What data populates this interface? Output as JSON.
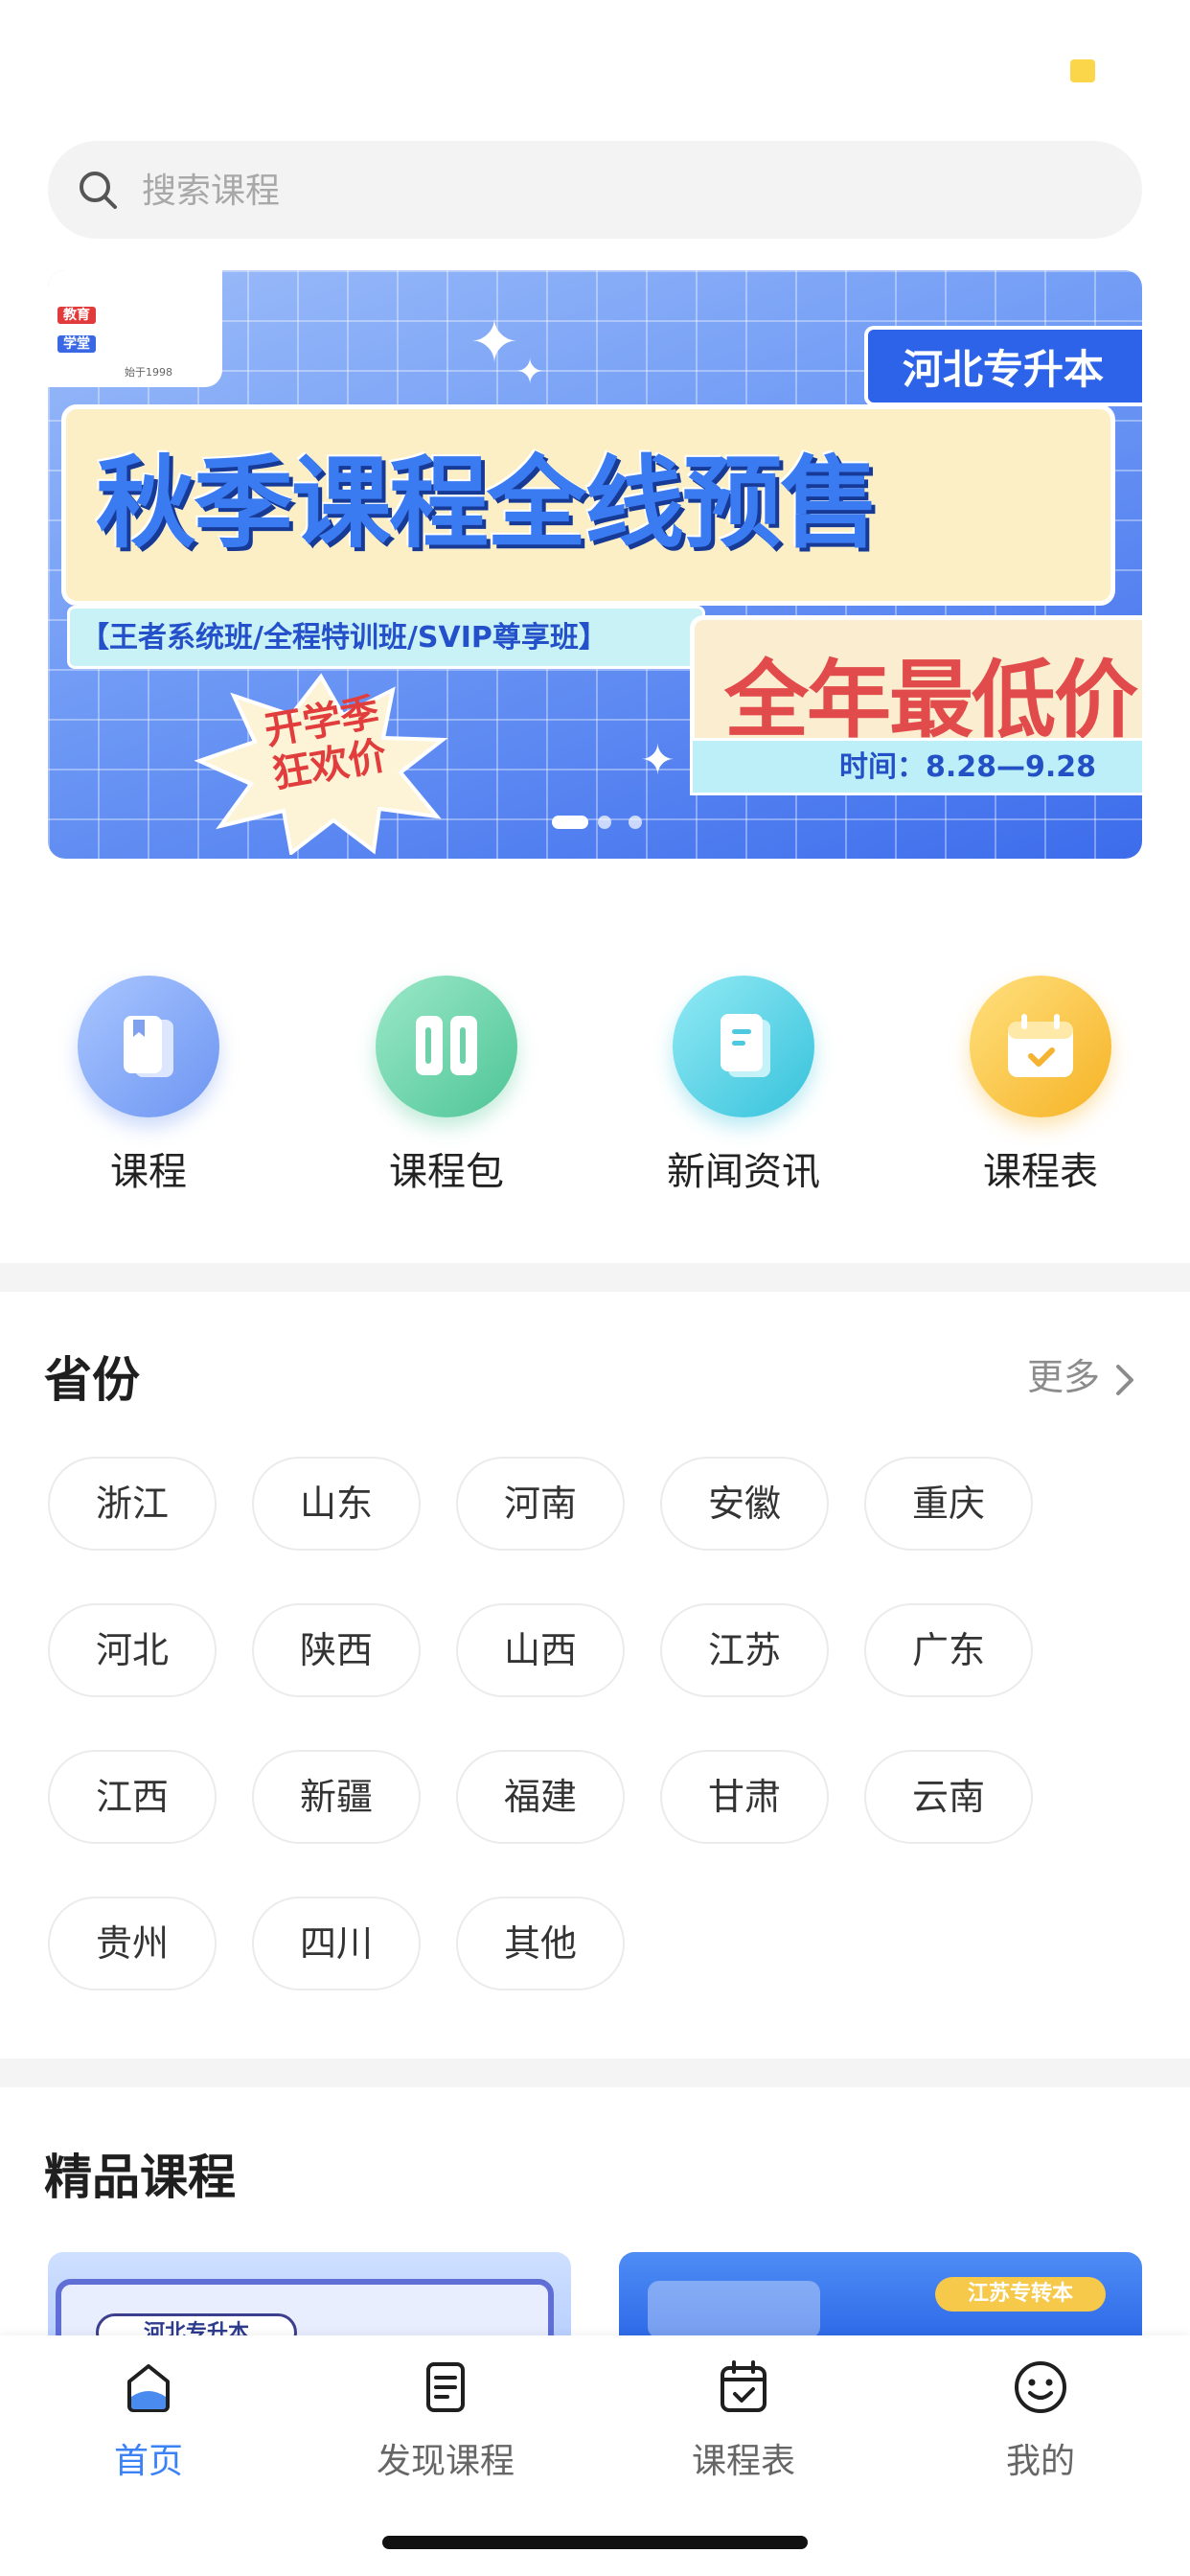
{
  "search": {
    "placeholder": "搜索课程"
  },
  "banner": {
    "logo_lines": [
      "教育",
      "学堂",
      "始于1998"
    ],
    "hebei_label": "河北专升本",
    "title": "秋季课程全线预售",
    "classes": "【王者系统班/全程特训班/SVIP尊享班】",
    "lowest": "全年最低价",
    "time": "时间：8.28—9.28",
    "burst": [
      "开学季",
      "狂欢价"
    ],
    "page_count": 3,
    "active_page": 1
  },
  "shortcuts": [
    {
      "label": "课程",
      "icon": "book-icon",
      "color_from": "#9FC0FF",
      "color_to": "#6D95F2"
    },
    {
      "label": "课程包",
      "icon": "package-icon",
      "color_from": "#8CE3C0",
      "color_to": "#52C79B"
    },
    {
      "label": "新闻资讯",
      "icon": "news-icon",
      "color_from": "#8BE6F2",
      "color_to": "#3EC7DE"
    },
    {
      "label": "课程表",
      "icon": "calendar-icon",
      "color_from": "#FFDA73",
      "color_to": "#F8B62C"
    }
  ],
  "provinces": {
    "title": "省份",
    "more": "更多",
    "items": [
      "浙江",
      "山东",
      "河南",
      "安徽",
      "重庆",
      "河北",
      "陕西",
      "山西",
      "江苏",
      "广东",
      "江西",
      "新疆",
      "福建",
      "甘肃",
      "云南",
      "贵州",
      "四川",
      "其他"
    ]
  },
  "featured": {
    "title": "精品课程",
    "cards": [
      {
        "tag": "河北专升本"
      },
      {
        "tag": "江苏专转本"
      }
    ]
  },
  "tabbar": {
    "active": "首页",
    "items": [
      {
        "label": "首页",
        "icon": "home-icon"
      },
      {
        "label": "发现课程",
        "icon": "discover-icon"
      },
      {
        "label": "课程表",
        "icon": "schedule-icon"
      },
      {
        "label": "我的",
        "icon": "profile-icon"
      }
    ]
  },
  "colors": {
    "accent": "#3B82F6",
    "status_dot": "#FBD64A"
  }
}
